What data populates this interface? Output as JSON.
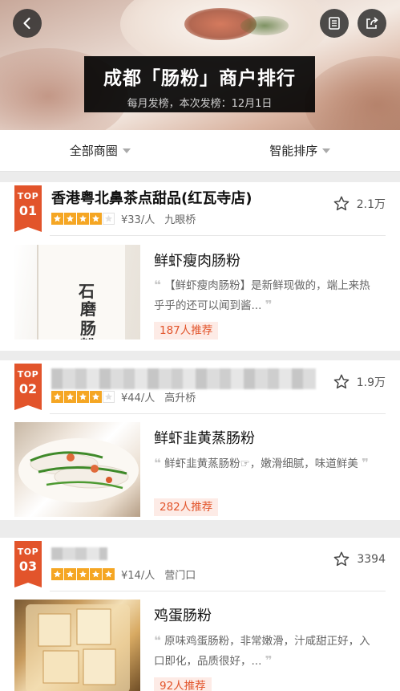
{
  "header": {
    "title": "成都「肠粉」商户排行",
    "subtitle": "每月发榜，本次发榜：12月1日",
    "back_icon": "chevron-left-icon",
    "doc_icon": "document-icon",
    "share_icon": "share-icon"
  },
  "filters": [
    {
      "label": "全部商圈"
    },
    {
      "label": "智能排序"
    }
  ],
  "ranking": [
    {
      "rank_top": "TOP",
      "rank_num": "01",
      "name": "香港粤北鼻茶点甜品(红瓦寺店)",
      "rating": 4,
      "price": "¥33/人",
      "area": "九眼桥",
      "favorites": "2.1万",
      "dish": "鲜虾瘦肉肠粉",
      "desc": "【鲜虾瘦肉肠粉】是新鲜现做的，端上来热乎乎的还可以闻到酱...",
      "recommend": "187人推荐"
    },
    {
      "rank_top": "TOP",
      "rank_num": "02",
      "name": "",
      "rating": 4,
      "price": "¥44/人",
      "area": "高升桥",
      "favorites": "1.9万",
      "dish": "鲜虾韭黄蒸肠粉",
      "desc": "鲜虾韭黄蒸肠粉☞，嫩滑细腻，味道鲜美",
      "recommend": "282人推荐"
    },
    {
      "rank_top": "TOP",
      "rank_num": "03",
      "name": "",
      "rating": 5,
      "price": "¥14/人",
      "area": "营门口",
      "favorites": "3394",
      "dish": "鸡蛋肠粉",
      "desc": "原味鸡蛋肠粉，非常嫩滑，汁咸甜正好，入口即化，品质很好，...",
      "recommend": "92人推荐"
    }
  ],
  "colors": {
    "accent": "#e2542b",
    "star": "#f5a623",
    "recommend_bg": "#fdebe6"
  }
}
